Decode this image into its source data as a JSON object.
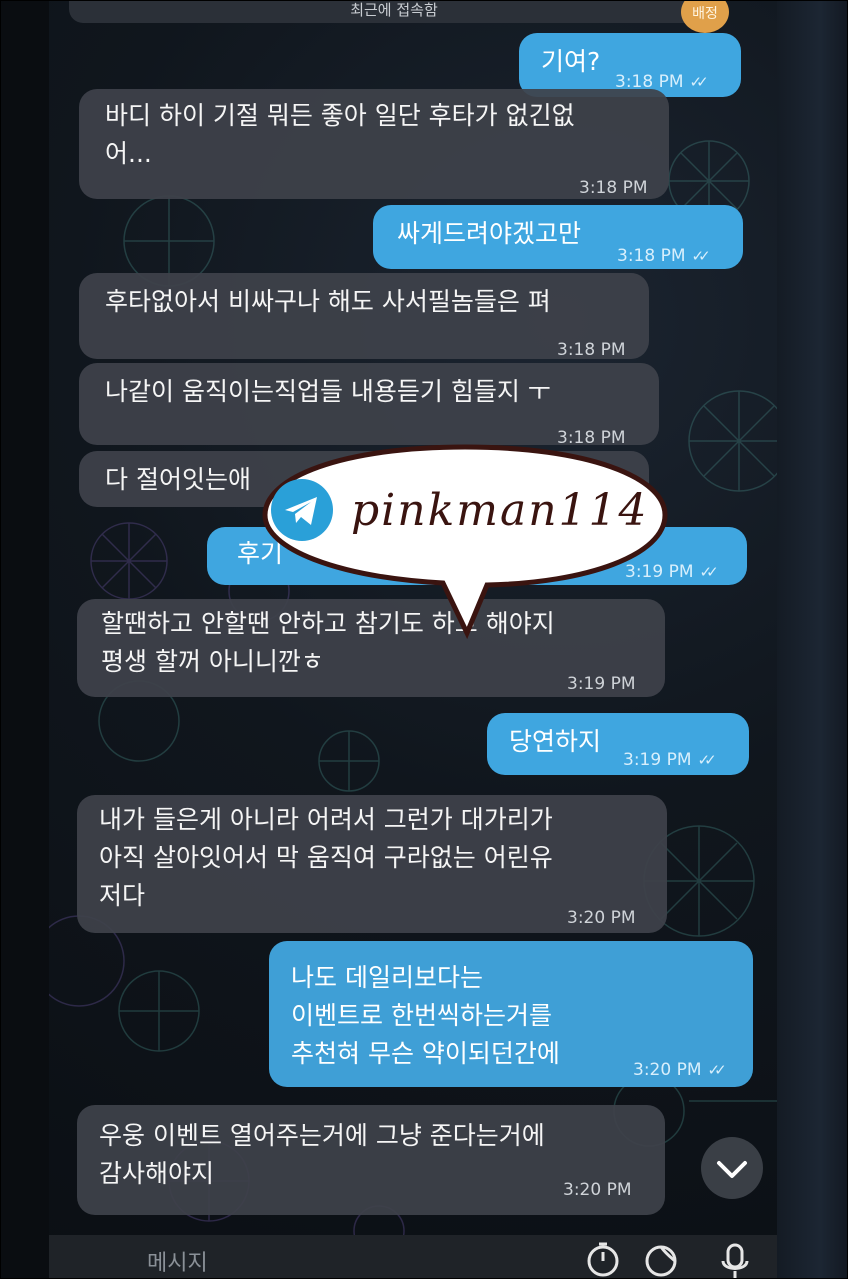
{
  "header": {
    "status_text": "최근에 접속함",
    "corner_button": "배정"
  },
  "messages": [
    {
      "dir": "out",
      "text": "기여?",
      "time": "3:18 PM",
      "read": true
    },
    {
      "dir": "in",
      "text": "바디 하이 기절 뭐든 좋아 일단 후타가 없긴없\n어...",
      "time": "3:18 PM"
    },
    {
      "dir": "out",
      "text": "싸게드려야겠고만",
      "time": "3:18 PM",
      "read": true
    },
    {
      "dir": "in",
      "text": "후타없아서 비싸구나 해도 사서필놈들은 펴",
      "time": "3:18 PM"
    },
    {
      "dir": "in",
      "text": "나같이 움직이는직업들 내용듣기 힘들지 ㅜ",
      "time": "3:18 PM"
    },
    {
      "dir": "in",
      "text": "다 절어잇는애",
      "time": ""
    },
    {
      "dir": "out",
      "text": "후기",
      "time": "3:19 PM",
      "read": true
    },
    {
      "dir": "in",
      "text": "할땐하고 안할땐 안하고 참기도 하고 해야지\n평생 할꺼 아니니깐ㅎ",
      "time": "3:19 PM"
    },
    {
      "dir": "out",
      "text": "당연하지",
      "time": "3:19 PM",
      "read": true
    },
    {
      "dir": "in",
      "text": "내가 들은게 아니라 어려서 그런가 대가리가\n아직 살아잇어서 막 움직여 구라없는 어린유\n저다",
      "time": "3:20 PM"
    },
    {
      "dir": "out",
      "text": "나도 데일리보다는\n이벤트로 한번씩하는거를\n추천혀 무슨 약이되던간에",
      "time": "3:20 PM",
      "read": true
    },
    {
      "dir": "in",
      "text": "우웅 이벤트 열어주는거에 그냥 준다는거에\n감사해야지",
      "time": "3:20 PM"
    }
  ],
  "watermark": {
    "text": "pinkman114",
    "icon": "telegram-icon"
  },
  "composer": {
    "placeholder": "메시지"
  },
  "icons": {
    "scroll_down": "chevron-down-icon",
    "timer": "timer-icon",
    "sticker": "sticker-icon",
    "mic": "microphone-icon"
  },
  "colors": {
    "incoming_bubble": "#3e424a",
    "outgoing_bubble": "#3fa6e0",
    "background": "#0e1116",
    "watermark_text": "#3a1410"
  }
}
